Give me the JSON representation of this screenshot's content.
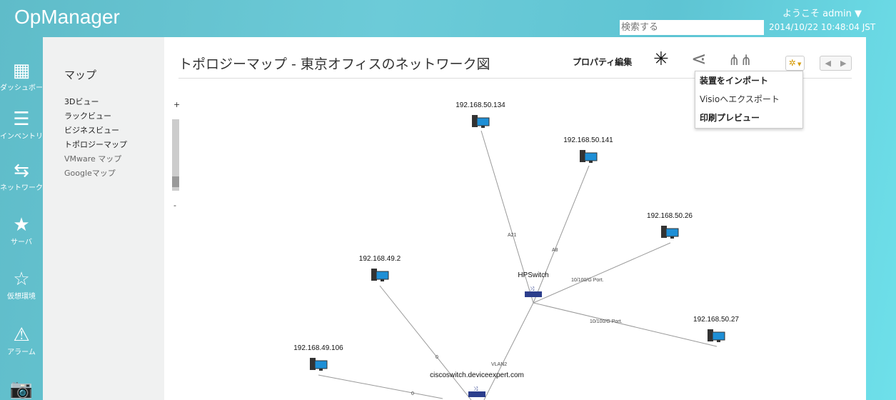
{
  "header": {
    "app_title": "OpManager",
    "welcome": "ようこそ admin",
    "welcome_caret": "▼",
    "search_placeholder": "検索する",
    "datetime": "2014/10/22 10:48:04 JST"
  },
  "nav": [
    {
      "label": "ダッシュボード",
      "icon": "dashboard-icon"
    },
    {
      "label": "インベントリ",
      "icon": "list-icon"
    },
    {
      "label": "ネットワーク",
      "icon": "arrows-icon"
    },
    {
      "label": "サーバ",
      "icon": "star-icon"
    },
    {
      "label": "仮想環境",
      "icon": "star-outline-icon"
    },
    {
      "label": "アラーム",
      "icon": "warning-icon"
    },
    {
      "label": "",
      "icon": "camera-icon"
    }
  ],
  "submenu": {
    "title": "マップ",
    "items": [
      "3Dビュー",
      "ラックビュー",
      "ビジネスビュー",
      "トポロジーマップ",
      "VMware マップ",
      "Googleマップ"
    ]
  },
  "page": {
    "title": "トポロジーマップ - 東京オフィスのネットワーク図",
    "property_edit": "プロパティ編集"
  },
  "gear_menu": {
    "items": [
      "装置をインポート",
      "Visioへエクスポート",
      "印刷プレビュー"
    ]
  },
  "zoom": {
    "plus": "+",
    "minus": "-"
  },
  "map": {
    "nodes": [
      "192.168.50.134",
      "192.168.50.141",
      "192.168.50.26",
      "192.168.49.2",
      "HPSwitch",
      "192.168.50.27",
      "192.168.49.106",
      "ciscoswitch.deviceexpert.com"
    ],
    "links": [
      {
        "from": "192.168.50.134",
        "to": "HPSwitch",
        "label": "A21"
      },
      {
        "from": "192.168.50.141",
        "to": "HPSwitch",
        "label": "A8"
      },
      {
        "from": "192.168.50.26",
        "to": "HPSwitch",
        "label": "10/100/G Port."
      },
      {
        "from": "192.168.50.27",
        "to": "HPSwitch",
        "label": "10/100/G Port."
      },
      {
        "from": "ciscoswitch.deviceexpert.com",
        "to": "HPSwitch",
        "label": "VLAN2"
      },
      {
        "from": "192.168.49.2",
        "to": "ciscoswitch.deviceexpert.com",
        "label": "0"
      },
      {
        "from": "192.168.49.106",
        "to": "ciscoswitch.deviceexpert.com",
        "label": "0"
      }
    ]
  },
  "colors": {
    "accent": "#5ec4d3",
    "gear": "#d69a00"
  }
}
